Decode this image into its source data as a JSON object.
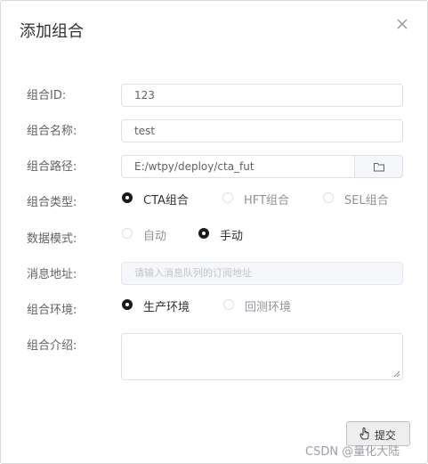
{
  "dialog": {
    "title": "添加组合",
    "close_icon": "close-icon"
  },
  "form": {
    "id": {
      "label": "组合ID:",
      "value": "123"
    },
    "name": {
      "label": "组合名称:",
      "value": "test"
    },
    "path": {
      "label": "组合路径:",
      "value": "E:/wtpy/deploy/cta_fut",
      "button_icon": "folder-icon"
    },
    "type": {
      "label": "组合类型:",
      "options": [
        "CTA组合",
        "HFT组合",
        "SEL组合"
      ],
      "selected": "CTA组合"
    },
    "mode": {
      "label": "数据模式:",
      "options": [
        "自动",
        "手动"
      ],
      "selected": "手动"
    },
    "msg_addr": {
      "label": "消息地址:",
      "placeholder": "请输入消息队列的订阅地址"
    },
    "env": {
      "label": "组合环境:",
      "options": [
        "生产环境",
        "回测环境"
      ],
      "selected": "生产环境"
    },
    "desc": {
      "label": "组合介绍:",
      "value": ""
    }
  },
  "footer": {
    "submit_label": "提交",
    "submit_icon": "hand-pointer-icon"
  },
  "watermark": "CSDN @量化大陆",
  "colors": {
    "radio_checked": "#1a1a1a",
    "border": "#dcdfe6",
    "disabled_bg": "#f5f7fa"
  }
}
